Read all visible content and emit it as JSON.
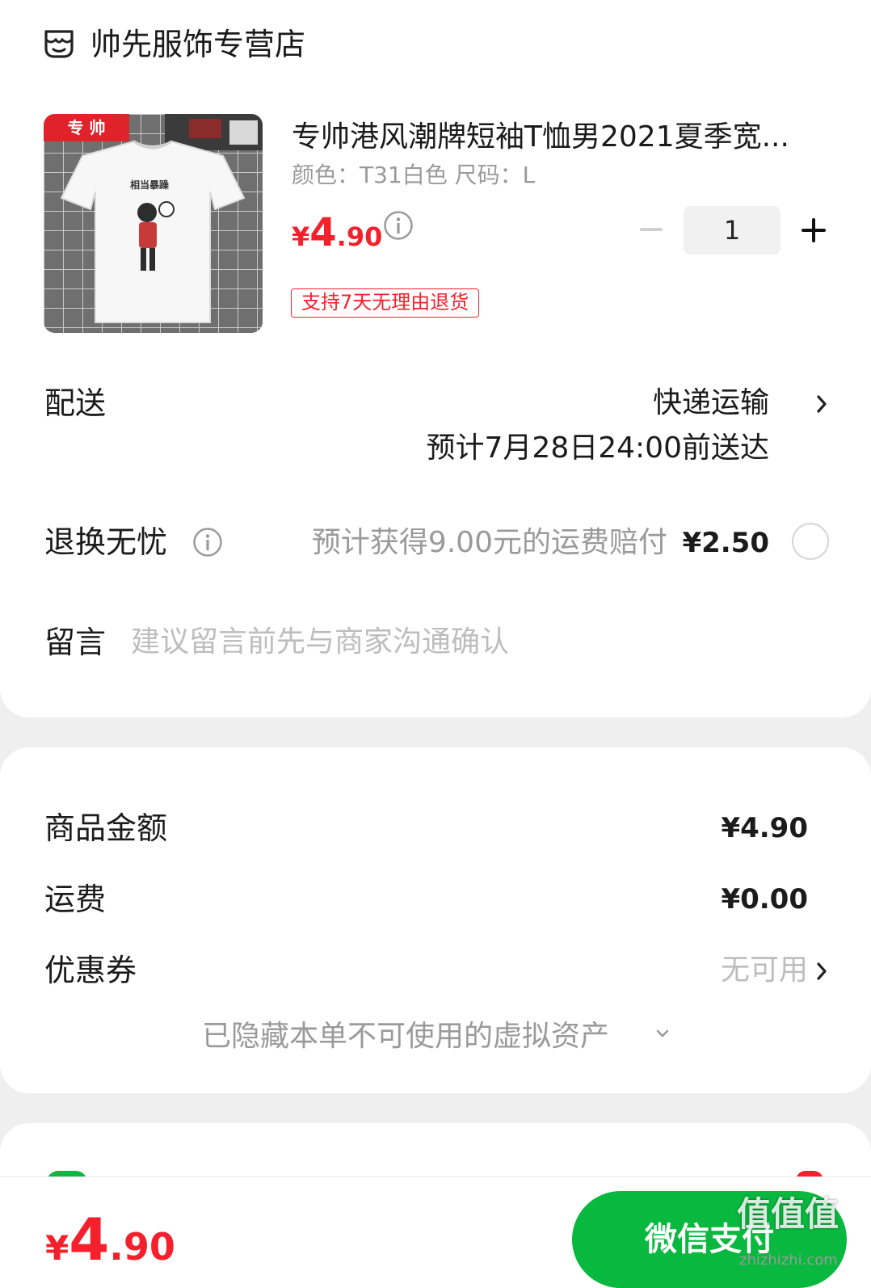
{
  "store": {
    "name": "帅先服饰专营店",
    "icon": "store-icon"
  },
  "product": {
    "image_badge": "专 帅",
    "image_print": "相当暴躁",
    "title": "专帅港风潮牌短袖T恤男2021夏季宽...",
    "spec": "颜色：T31白色   尺码：L",
    "price_currency": "¥",
    "price_int": "4",
    "price_dec": ".90",
    "quantity": "1",
    "return_tag": "支持7天无理由退货"
  },
  "delivery": {
    "label": "配送",
    "method": "快递运输",
    "eta": "预计7月28日24:00前送达"
  },
  "insurance": {
    "label": "退换无忧",
    "desc": "预计获得9.00元的运费赔付",
    "price": "¥2.50",
    "checked": false
  },
  "message": {
    "label": "留言",
    "placeholder": "建议留言前先与商家沟通确认"
  },
  "summary": {
    "goods_label": "商品金额",
    "goods_value": "¥4.90",
    "shipping_label": "运费",
    "shipping_value": "¥0.00",
    "coupon_label": "优惠券",
    "coupon_value": "无可用",
    "hidden_assets": "已隐藏本单不可使用的虚拟资产"
  },
  "footer": {
    "total_currency": "¥",
    "total_int": "4",
    "total_dec": ".90",
    "pay_label": "微信支付",
    "watermark": "值值值",
    "watermark_url": "zhizhizhi.com"
  },
  "colors": {
    "accent_red": "#f4212d",
    "wechat_green": "#09b83e"
  }
}
